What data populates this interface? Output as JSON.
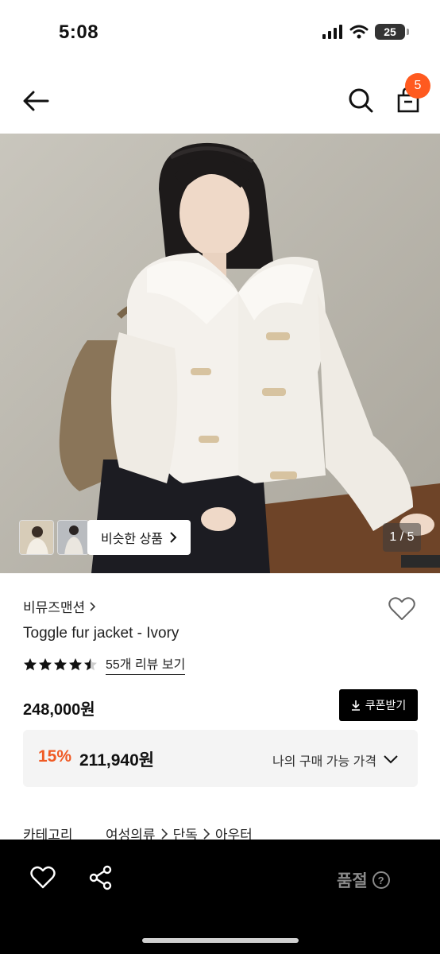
{
  "status_bar": {
    "time": "5:08",
    "battery": "25"
  },
  "nav": {
    "cart_count": "5"
  },
  "hero": {
    "similar_label": "비슷한 상품",
    "page_indicator": "1 / 5"
  },
  "product": {
    "brand": "비뮤즈맨션",
    "name": "Toggle fur jacket - Ivory",
    "rating": 4.5,
    "review_link": "55개 리뷰 보기",
    "price": "248,000원",
    "coupon_label": "쿠폰받기",
    "discount_rate": "15%",
    "discount_price": "211,940원",
    "my_price_label": "나의 구매 가능 가격"
  },
  "category": {
    "label": "카테고리",
    "path": [
      "여성의류",
      "단독",
      "아우터"
    ]
  },
  "bottom_bar": {
    "soldout_label": "품절",
    "help_glyph": "?"
  },
  "colors": {
    "accent": "#ff5a1f",
    "discount": "#f05a24",
    "bar": "#000000"
  }
}
